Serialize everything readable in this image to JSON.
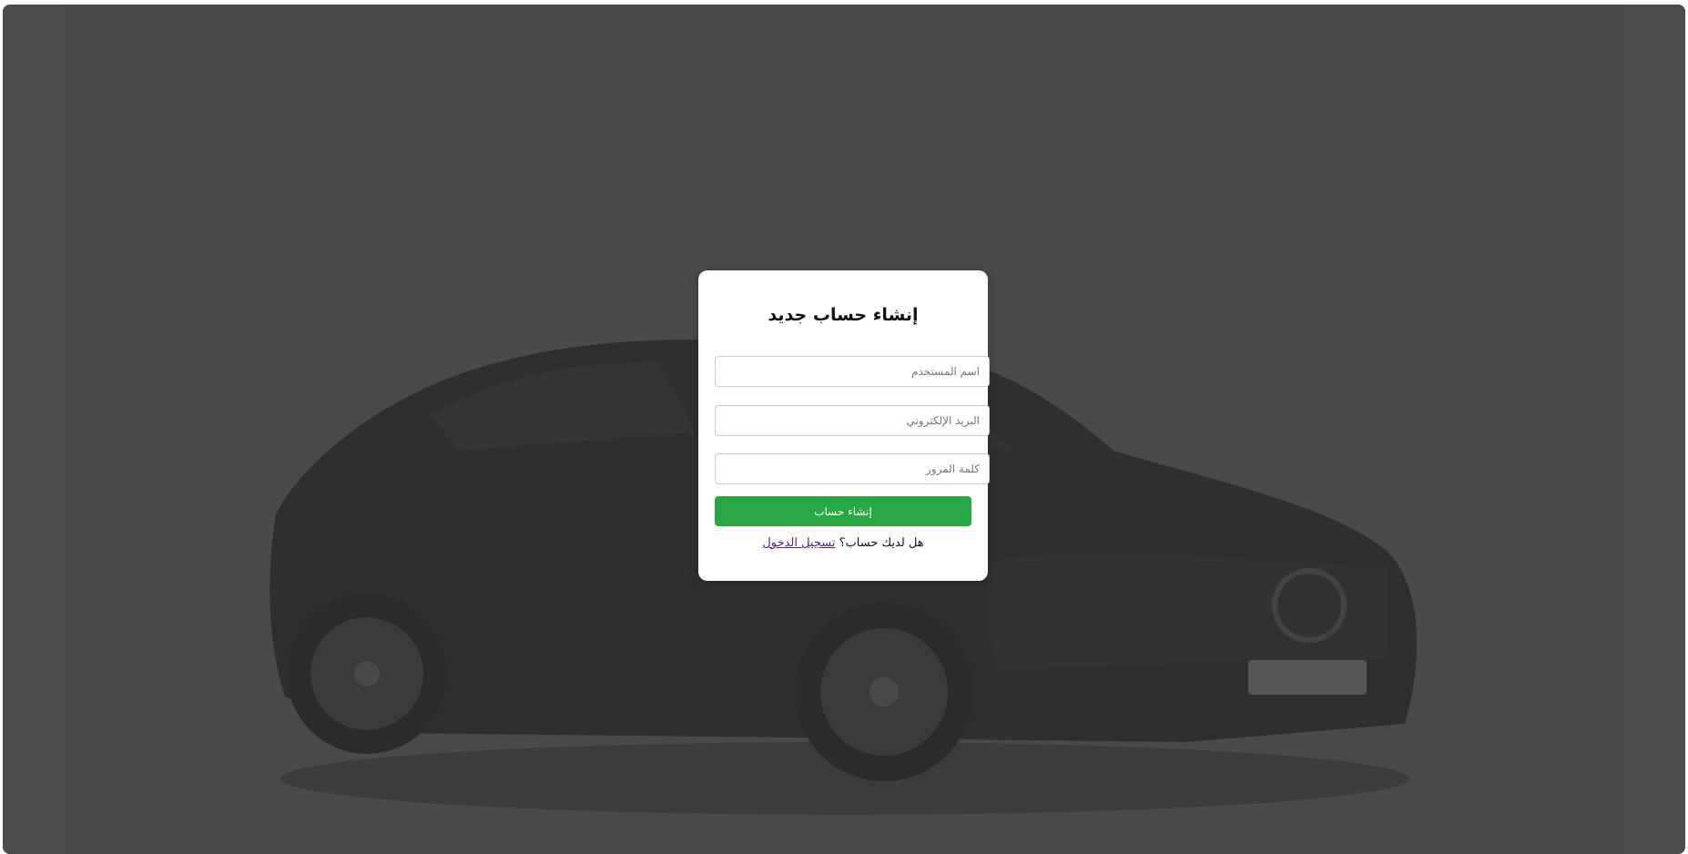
{
  "colors": {
    "background": "#444444",
    "card": "#ffffff",
    "submit_button": "#28a745",
    "link": "#551a8b"
  },
  "background": {
    "image": "black-sedan-car"
  },
  "signup": {
    "title": "إنشاء حساب جديد",
    "username_placeholder": "اسم المستخدم",
    "email_placeholder": "البريد الإلكتروني",
    "password_placeholder": "كلمة المرور",
    "submit_label": "إنشاء حساب",
    "have_account_text": "هل لديك حساب؟",
    "login_link_label": "تسجيل الدخول"
  }
}
